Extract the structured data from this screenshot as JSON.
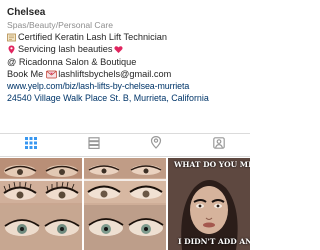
{
  "profile": {
    "name": "Chelsea",
    "category": "Spas/Beauty/Personal Care",
    "bio_lines": [
      {
        "icon": "certificate-icon",
        "text": "Certified Keratin Lash Lift Technician"
      },
      {
        "icon": "location-pin-icon",
        "text": "Servicing lash beauties",
        "trailing_icon": "heart-icon"
      },
      {
        "icon": "",
        "text": "@ Ricadonna Salon & Boutique"
      },
      {
        "icon": "",
        "text": "Book Me",
        "trailing_icon": "envelope-icon",
        "suffix": "lashliftsbychels@gmail.com"
      }
    ],
    "website": "www.yelp.com/biz/lash-lifts-by-chelsea-murrieta",
    "address": "24540 Village Walk Place St. B, Murrieta, California"
  },
  "tabs": [
    {
      "name": "grid-view",
      "icon": "grid-icon",
      "active": true
    },
    {
      "name": "list-view",
      "icon": "list-icon",
      "active": false
    },
    {
      "name": "location-view",
      "icon": "map-pin-icon",
      "active": false
    },
    {
      "name": "tagged-view",
      "icon": "tagged-icon",
      "active": false
    }
  ],
  "colors": {
    "link": "#003569",
    "muted": "#8e8e8e",
    "active_tab": "#3897f0",
    "inactive_tab": "#999999"
  },
  "posts": [
    {
      "overlay_text": ""
    },
    {
      "overlay_text": ""
    },
    {
      "overlay_text_top": "WHAT DO YOU MEAN...",
      "overlay_text_bottom": "I DIDN'T ADD ANY?????!"
    }
  ]
}
